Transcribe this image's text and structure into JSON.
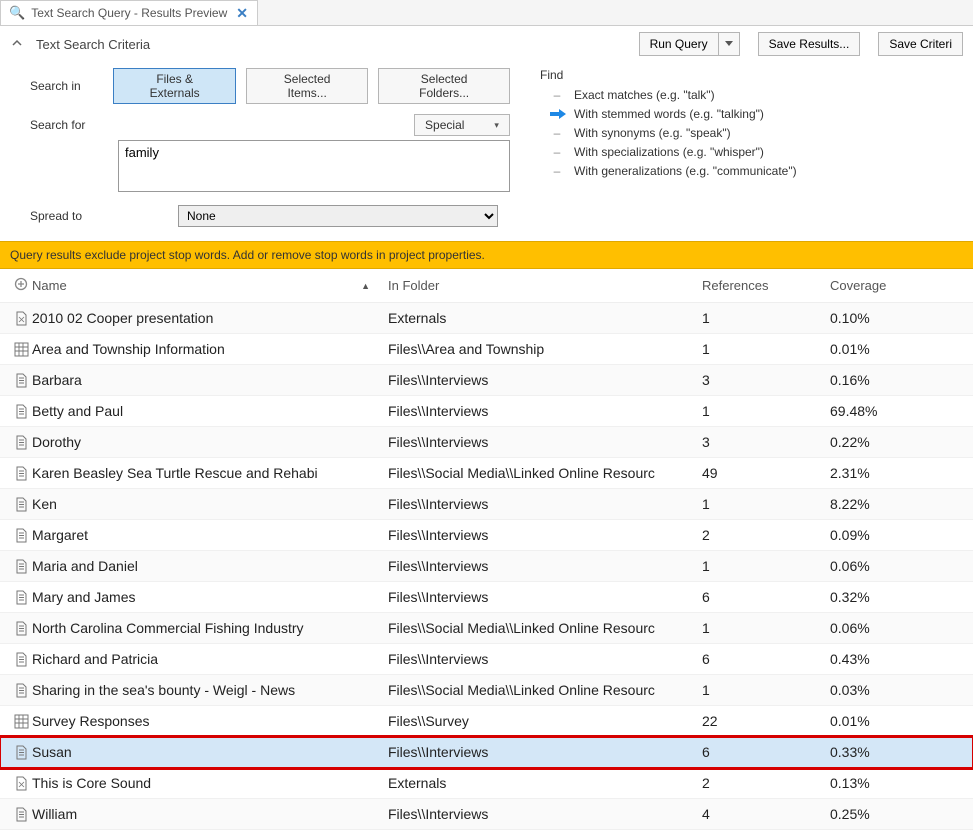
{
  "tab": {
    "title": "Text Search Query - Results Preview"
  },
  "criteria": {
    "title": "Text Search Criteria",
    "run_query_label": "Run Query",
    "save_results_label": "Save Results...",
    "save_criteria_label": "Save Criteri",
    "search_in_label": "Search in",
    "pills": {
      "files_externals": "Files & Externals",
      "selected_items": "Selected Items...",
      "selected_folders": "Selected Folders..."
    },
    "search_for_label": "Search for",
    "special_label": "Special",
    "search_value": "family",
    "spread_to_label": "Spread to",
    "spread_to_value": "None",
    "find_label": "Find",
    "match_options": [
      "Exact matches (e.g. \"talk\")",
      "With stemmed words (e.g. \"talking\")",
      "With synonyms (e.g. \"speak\")",
      "With specializations (e.g. \"whisper\")",
      "With generalizations (e.g. \"communicate\")"
    ],
    "match_selected_index": 1
  },
  "stopwords_msg": "Query results exclude project stop words. Add or remove stop words in project properties.",
  "columns": {
    "name": "Name",
    "folder": "In Folder",
    "references": "References",
    "coverage": "Coverage"
  },
  "rows": [
    {
      "icon": "pdf",
      "name": "2010 02 Cooper presentation",
      "folder": "Externals",
      "references": "1",
      "coverage": "0.10%"
    },
    {
      "icon": "grid",
      "name": "Area and Township Information",
      "folder": "Files\\\\Area and Township",
      "references": "1",
      "coverage": "0.01%"
    },
    {
      "icon": "doc",
      "name": "Barbara",
      "folder": "Files\\\\Interviews",
      "references": "3",
      "coverage": "0.16%"
    },
    {
      "icon": "doc",
      "name": "Betty and Paul",
      "folder": "Files\\\\Interviews",
      "references": "1",
      "coverage": "69.48%"
    },
    {
      "icon": "doc",
      "name": "Dorothy",
      "folder": "Files\\\\Interviews",
      "references": "3",
      "coverage": "0.22%"
    },
    {
      "icon": "doc",
      "name": "Karen Beasley Sea Turtle Rescue and Rehabi",
      "folder": "Files\\\\Social Media\\\\Linked Online Resourc",
      "references": "49",
      "coverage": "2.31%"
    },
    {
      "icon": "doc",
      "name": "Ken",
      "folder": "Files\\\\Interviews",
      "references": "1",
      "coverage": "8.22%"
    },
    {
      "icon": "doc",
      "name": "Margaret",
      "folder": "Files\\\\Interviews",
      "references": "2",
      "coverage": "0.09%"
    },
    {
      "icon": "doc",
      "name": "Maria and Daniel",
      "folder": "Files\\\\Interviews",
      "references": "1",
      "coverage": "0.06%"
    },
    {
      "icon": "doc",
      "name": "Mary and James",
      "folder": "Files\\\\Interviews",
      "references": "6",
      "coverage": "0.32%"
    },
    {
      "icon": "doc",
      "name": "North Carolina Commercial Fishing Industry",
      "folder": "Files\\\\Social Media\\\\Linked Online Resourc",
      "references": "1",
      "coverage": "0.06%"
    },
    {
      "icon": "doc",
      "name": "Richard and Patricia",
      "folder": "Files\\\\Interviews",
      "references": "6",
      "coverage": "0.43%"
    },
    {
      "icon": "doc",
      "name": "Sharing in the sea's bounty - Weigl - News",
      "folder": "Files\\\\Social Media\\\\Linked Online Resourc",
      "references": "1",
      "coverage": "0.03%"
    },
    {
      "icon": "grid",
      "name": "Survey Responses",
      "folder": "Files\\\\Survey",
      "references": "22",
      "coverage": "0.01%"
    },
    {
      "icon": "doc",
      "name": "Susan",
      "folder": "Files\\\\Interviews",
      "references": "6",
      "coverage": "0.33%",
      "highlight": true
    },
    {
      "icon": "pdf",
      "name": "This is Core Sound",
      "folder": "Externals",
      "references": "2",
      "coverage": "0.13%"
    },
    {
      "icon": "doc",
      "name": "William",
      "folder": "Files\\\\Interviews",
      "references": "4",
      "coverage": "0.25%"
    }
  ]
}
